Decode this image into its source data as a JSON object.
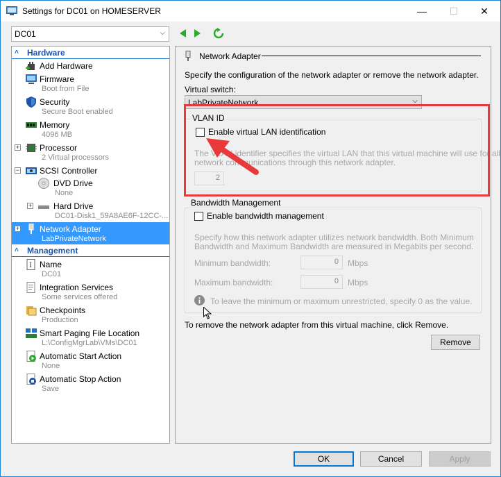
{
  "window": {
    "title": "Settings for DC01 on HOMESERVER"
  },
  "toolbar": {
    "vm_selected": "DC01"
  },
  "sidebar": {
    "hardware_label": "Hardware",
    "management_label": "Management",
    "hardware_items": [
      {
        "title": "Add Hardware",
        "sub": ""
      },
      {
        "title": "Firmware",
        "sub": "Boot from File"
      },
      {
        "title": "Security",
        "sub": "Secure Boot enabled"
      },
      {
        "title": "Memory",
        "sub": "4096 MB"
      },
      {
        "title": "Processor",
        "sub": "2 Virtual processors"
      },
      {
        "title": "SCSI Controller",
        "sub": ""
      },
      {
        "title": "DVD Drive",
        "sub": "None"
      },
      {
        "title": "Hard Drive",
        "sub": "DC01-Disk1_59A8AE6F-12CC-..."
      },
      {
        "title": "Network Adapter",
        "sub": "LabPrivateNetwork"
      }
    ],
    "management_items": [
      {
        "title": "Name",
        "sub": "DC01"
      },
      {
        "title": "Integration Services",
        "sub": "Some services offered"
      },
      {
        "title": "Checkpoints",
        "sub": "Production"
      },
      {
        "title": "Smart Paging File Location",
        "sub": "L:\\ConfigMgrLab\\VMs\\DC01"
      },
      {
        "title": "Automatic Start Action",
        "sub": "None"
      },
      {
        "title": "Automatic Stop Action",
        "sub": "Save"
      }
    ]
  },
  "main": {
    "header": "Network Adapter",
    "description": "Specify the configuration of the network adapter or remove the network adapter.",
    "virtual_switch_label": "Virtual switch:",
    "virtual_switch_value": "LabPrivateNetwork",
    "vlan": {
      "group_label": "VLAN ID",
      "checkbox_label": "Enable virtual LAN identification",
      "help_text_1": "The VLAN identifier specifies the virtual LAN that this virtual machine will use for all",
      "help_text_2": "network communications through this network adapter.",
      "value": "2"
    },
    "bandwidth": {
      "group_label": "Bandwidth Management",
      "checkbox_label": "Enable bandwidth management",
      "help_text_1": "Specify how this network adapter utilizes network bandwidth. Both Minimum",
      "help_text_2": "Bandwidth and Maximum Bandwidth are measured in Megabits per second.",
      "min_label": "Minimum bandwidth:",
      "min_value": "0",
      "max_label": "Maximum bandwidth:",
      "max_value": "0",
      "unit": "Mbps",
      "info_text": "To leave the minimum or maximum unrestricted, specify 0 as the value."
    },
    "remove_text": "To remove the network adapter from this virtual machine, click Remove.",
    "remove_button": "Remove"
  },
  "footer": {
    "ok": "OK",
    "cancel": "Cancel",
    "apply": "Apply"
  },
  "colors": {
    "highlight": "#e8393b",
    "selection": "#3399ff",
    "accent": "#1e72c6"
  }
}
